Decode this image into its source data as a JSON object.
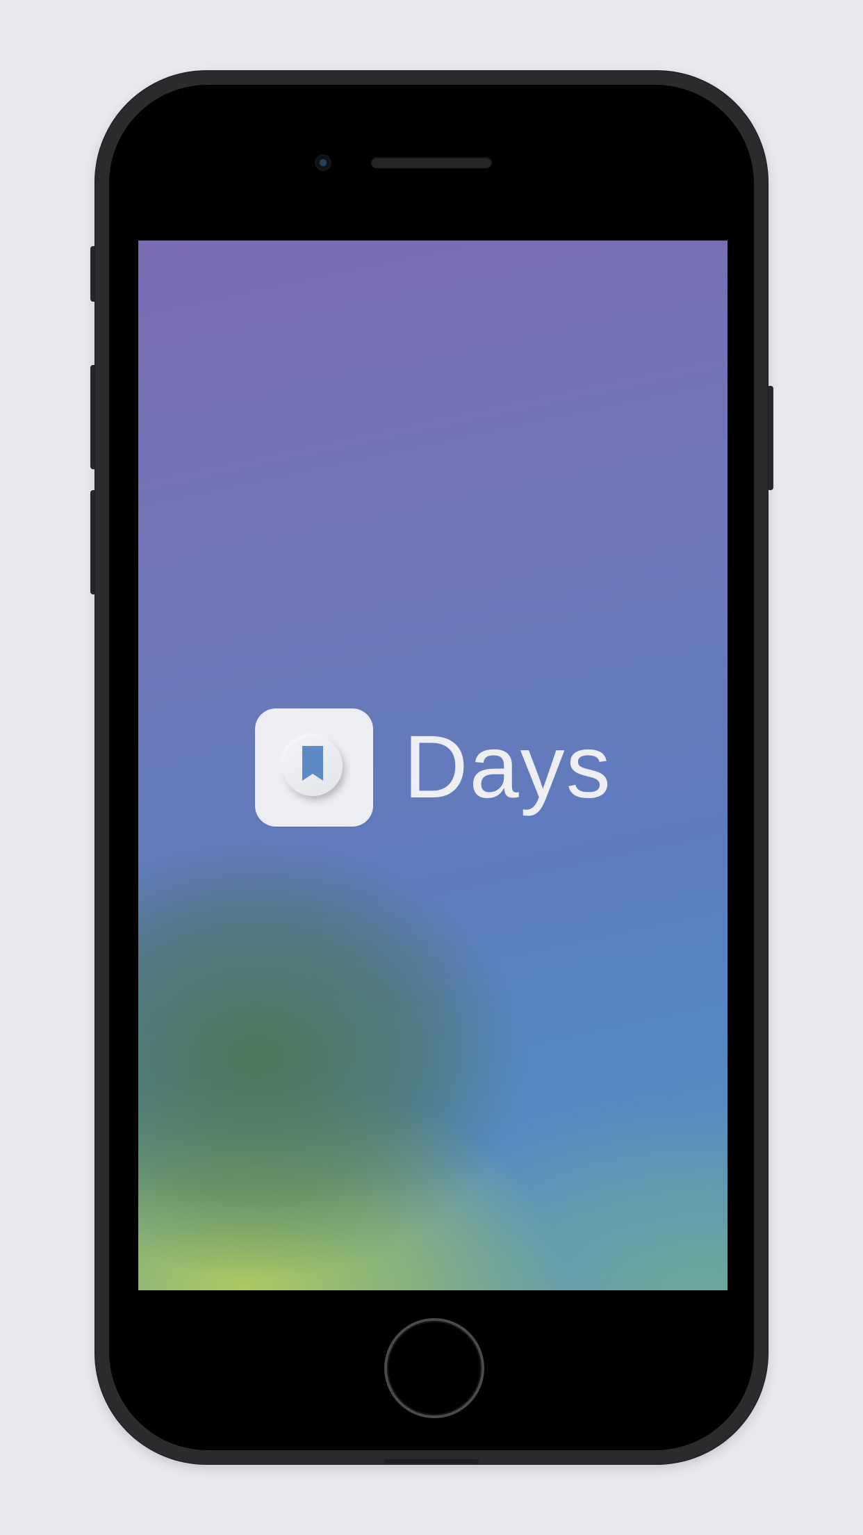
{
  "splash": {
    "app_name": "Days",
    "icon": "bookmark-icon",
    "accent_color": "#5b8ac6"
  },
  "device": {
    "frame_color": "#2b2b2d",
    "background_color": "#e9eaee"
  }
}
